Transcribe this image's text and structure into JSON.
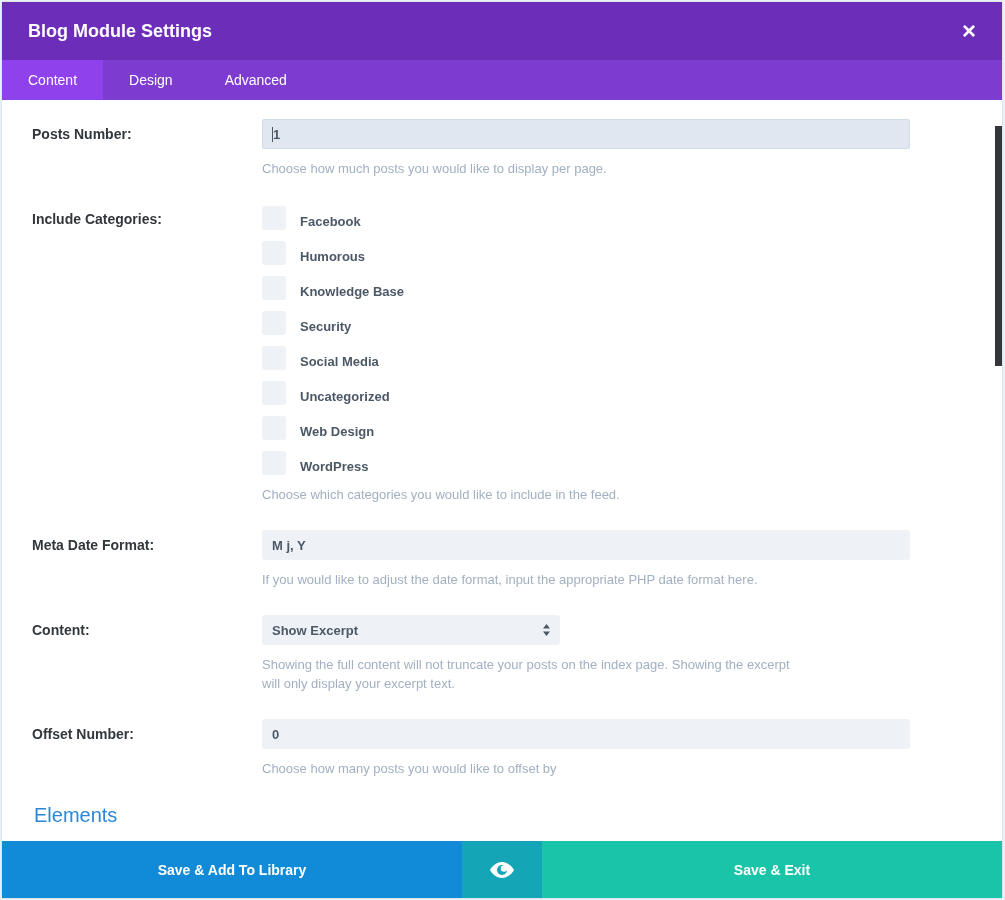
{
  "window": {
    "title": "Blog Module Settings",
    "close_icon": "×"
  },
  "tabs": [
    {
      "label": "Content",
      "selected": true
    },
    {
      "label": "Design",
      "selected": false
    },
    {
      "label": "Advanced",
      "selected": false
    }
  ],
  "settings": [
    {
      "kind": "text",
      "label": "Posts Number:",
      "value": "1",
      "focused": true,
      "description": "Choose how much posts you would like to display per page."
    },
    {
      "kind": "checkboxes",
      "label": "Include Categories:",
      "options": [
        {
          "label": "Facebook",
          "checked": false
        },
        {
          "label": "Humorous",
          "checked": false
        },
        {
          "label": "Knowledge Base",
          "checked": false
        },
        {
          "label": "Security",
          "checked": false
        },
        {
          "label": "Social Media",
          "checked": false
        },
        {
          "label": "Uncategorized",
          "checked": false
        },
        {
          "label": "Web Design",
          "checked": false
        },
        {
          "label": "WordPress",
          "checked": false
        }
      ],
      "description": "Choose which categories you would like to include in the feed."
    },
    {
      "kind": "text",
      "label": "Meta Date Format:",
      "value": "M j, Y",
      "focused": false,
      "description": "If you would like to adjust the date format, input the appropriate PHP date format here."
    },
    {
      "kind": "select",
      "label": "Content:",
      "value": "Show Excerpt",
      "description": "Showing the full content will not truncate your posts on the index page. Showing the excerpt will only display your excerpt text."
    },
    {
      "kind": "text",
      "label": "Offset Number:",
      "value": "0",
      "focused": false,
      "description": "Choose how many posts you would like to offset by"
    }
  ],
  "section_heading": "Elements",
  "footer": {
    "left_button": "Save & Add To Library",
    "right_button": "Save & Exit"
  }
}
